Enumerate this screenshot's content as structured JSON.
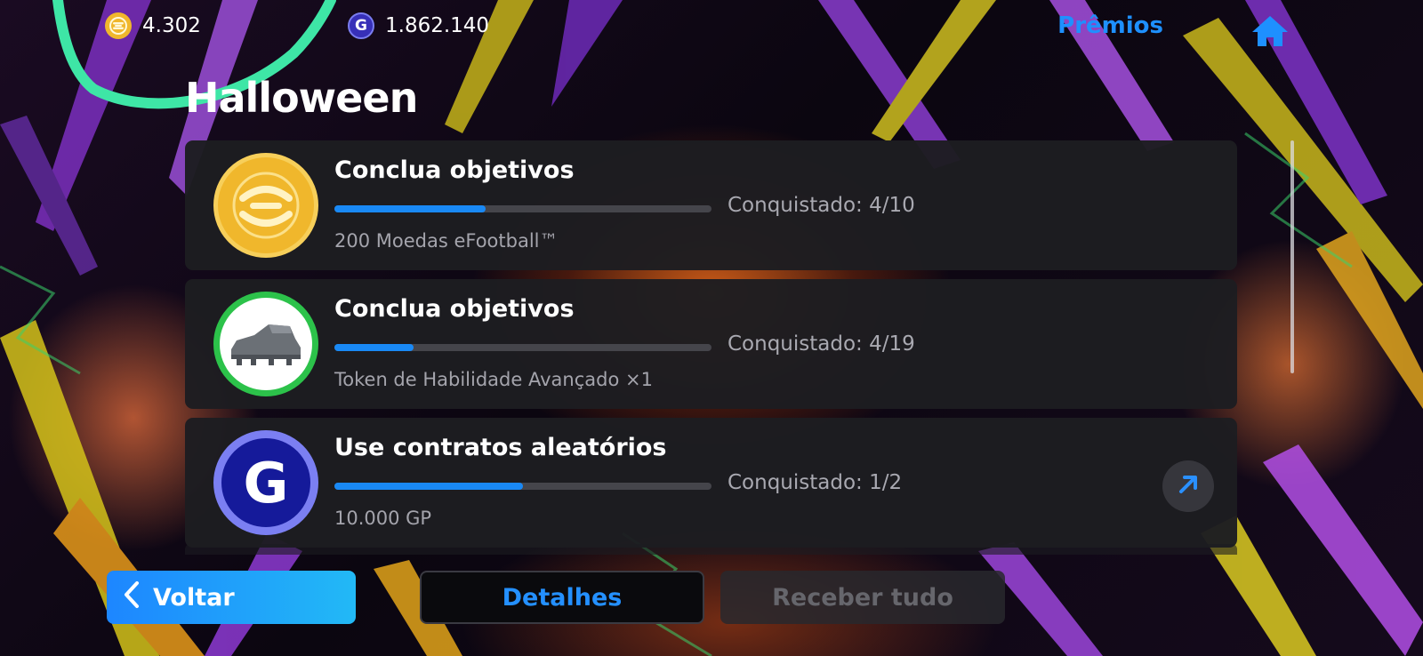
{
  "topbar": {
    "coins": {
      "value": "4.302",
      "icon": "efootball-coin-icon"
    },
    "gp": {
      "value": "1.862.140",
      "icon": "gp-icon",
      "symbol": "G"
    },
    "premios_label": "Prêmios",
    "home_icon": "home-icon"
  },
  "page": {
    "title": "Halloween"
  },
  "objectives": [
    {
      "title": "Conclua objetivos",
      "progress_text": "Conquistado: 4/10",
      "progress": 0.4,
      "reward": "200 Moedas eFootball™",
      "icon": "efootball-coin-icon"
    },
    {
      "title": "Conclua objetivos",
      "progress_text": "Conquistado: 4/19",
      "progress": 0.21,
      "reward": "Token de Habilidade Avançado ×1",
      "icon": "boot-icon"
    },
    {
      "title": "Use contratos aleatórios",
      "progress_text": "Conquistado: 1/2",
      "progress": 0.5,
      "reward": "10.000 GP",
      "icon": "gp-icon",
      "icon_symbol": "G",
      "action_icon": "arrow-up-right-icon"
    }
  ],
  "footer": {
    "back_label": "Voltar",
    "details_label": "Detalhes",
    "receive_all_label": "Receber tudo"
  },
  "colors": {
    "accent": "#1e90ff",
    "gold": "#f0b72c",
    "gp_purple": "#3730b8",
    "boot_green": "#2cc24a",
    "annotation": "#3ee6a6"
  }
}
